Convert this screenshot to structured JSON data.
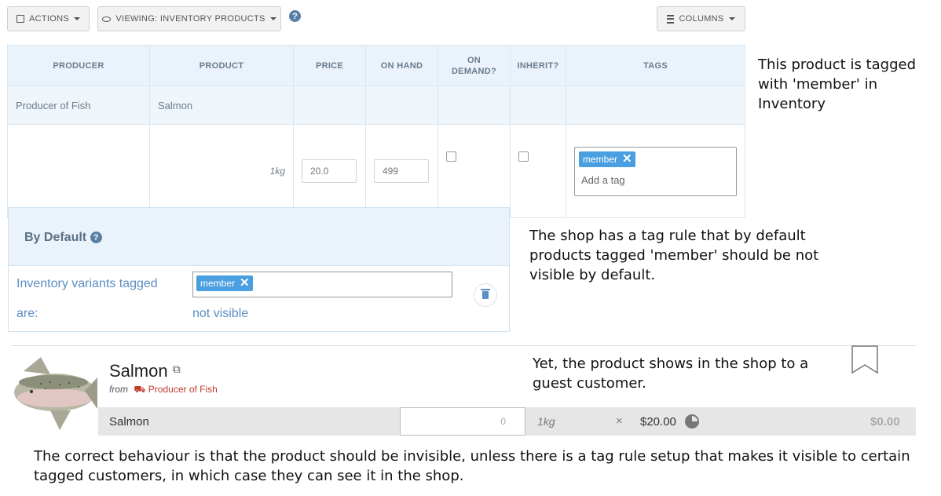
{
  "toolbar": {
    "actions_label": "ACTIONS",
    "viewing_label": "VIEWING: INVENTORY PRODUCTS",
    "columns_label": "COLUMNS",
    "help_glyph": "?"
  },
  "table": {
    "headers": [
      "PRODUCER",
      "PRODUCT",
      "PRICE",
      "ON HAND",
      "ON DEMAND?",
      "INHERIT?",
      "TAGS"
    ],
    "product_row": {
      "producer": "Producer of Fish",
      "product": "Salmon"
    },
    "variant_row": {
      "unit": "1kg",
      "price": "20.0",
      "on_hand": "499",
      "tags": [
        "member"
      ],
      "tag_placeholder": "Add a tag"
    }
  },
  "default_rule": {
    "title": "By Default",
    "label_line1": "Inventory variants tagged",
    "label_line2": "are:",
    "tag": "member",
    "visibility": "not visible"
  },
  "shop": {
    "product_name": "Salmon",
    "from_label": "from",
    "producer": "Producer of Fish",
    "variant_name": "Salmon",
    "quantity": "0",
    "unit": "1kg",
    "times": "×",
    "price": "$20.00",
    "total": "$0.00"
  },
  "annotations": {
    "note1": "This product is tagged with 'member' in Inventory",
    "note2": "The shop has a tag rule that by default products tagged 'member' should be not visible by default.",
    "note3": "Yet, the product shows in the shop to a guest customer.",
    "note4": "The correct behaviour is that the product should be invisible, unless there is a tag rule setup that makes it visible to certain tagged customers, in which case they can see it in the shop."
  },
  "colors": {
    "accent": "#4a9fe0",
    "header_bg": "#eaf3fb",
    "producer_link": "#c0392b"
  }
}
